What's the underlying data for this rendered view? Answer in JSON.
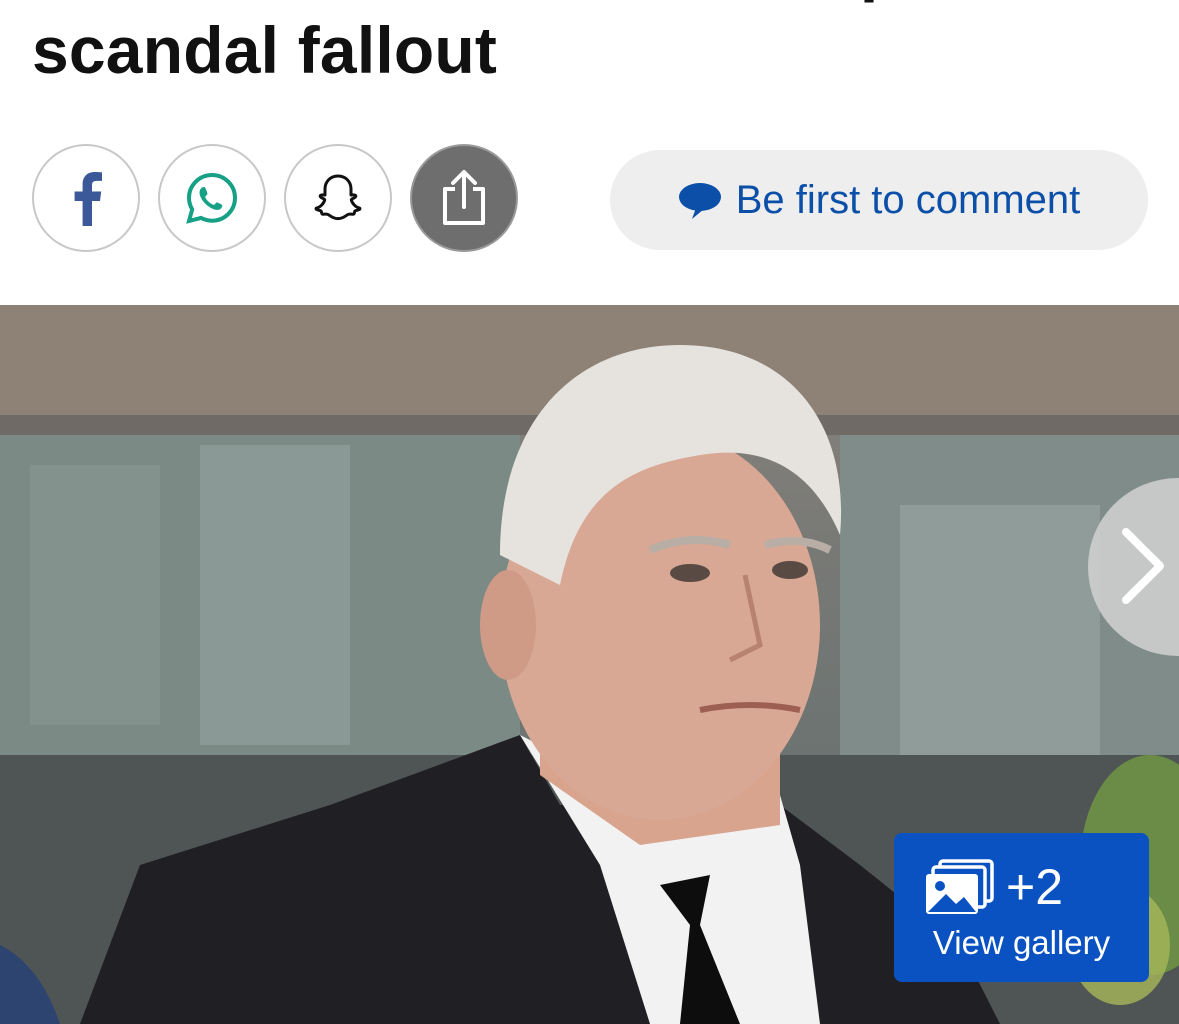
{
  "article": {
    "headline_line1": "Prince Andrew seeks to repair",
    "headline_line2": "scandal fallout"
  },
  "share": {
    "facebook_icon": "facebook-icon",
    "whatsapp_icon": "whatsapp-icon",
    "snapchat_icon": "snapchat-icon",
    "share_icon": "share-icon"
  },
  "comments": {
    "label": "Be first to comment",
    "icon": "speech-bubble-icon",
    "color": "#0b4fa8"
  },
  "gallery": {
    "count": "+2",
    "label": "View gallery",
    "icon": "photo-gallery-icon",
    "accent": "#0a52c2"
  },
  "carousel": {
    "next_icon": "chevron-right-icon"
  }
}
